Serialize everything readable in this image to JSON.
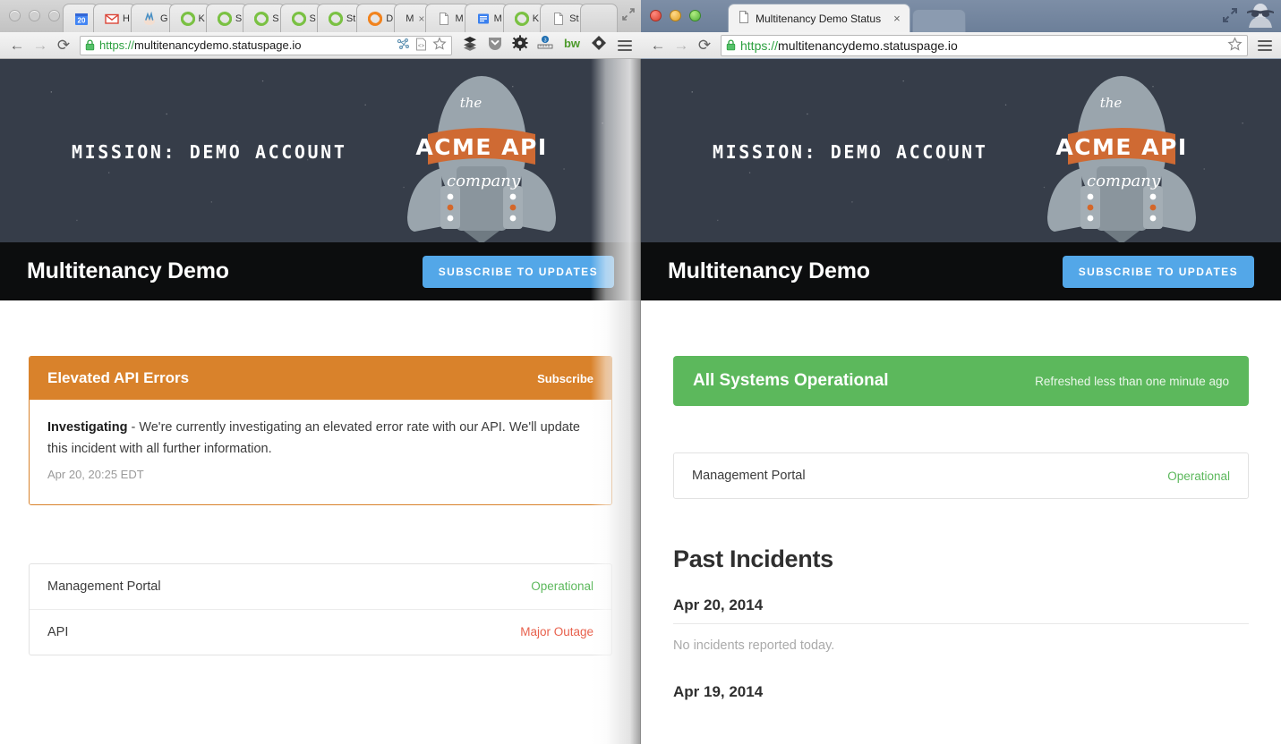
{
  "left_window": {
    "active": false,
    "traffic_lights": [
      "close",
      "minimize",
      "zoom"
    ],
    "tabs": [
      {
        "icon": "calendar-icon",
        "label": "20",
        "title": "20"
      },
      {
        "icon": "gmail-icon",
        "label": "H"
      },
      {
        "icon": "hand-icon",
        "label": "G"
      },
      {
        "icon": "statuspage-icon",
        "label": "K"
      },
      {
        "icon": "statuspage-icon",
        "label": "S"
      },
      {
        "icon": "statuspage-icon",
        "label": "S"
      },
      {
        "icon": "statuspage-icon",
        "label": "S"
      },
      {
        "icon": "statuspage-icon",
        "label": "St"
      },
      {
        "icon": "statuspage-orange-icon",
        "label": "D"
      },
      {
        "icon": "blank-icon",
        "label": "M",
        "closing": true
      },
      {
        "icon": "document-icon",
        "label": "M"
      },
      {
        "icon": "blue-doc-icon",
        "label": "M"
      },
      {
        "icon": "statuspage-icon",
        "label": "K"
      },
      {
        "icon": "document-icon",
        "label": "St"
      },
      {
        "icon": "empty-tab",
        "label": ""
      }
    ],
    "toolbar": {
      "back": "←",
      "forward": "→",
      "reload": "⟳",
      "url_scheme": "https://",
      "url_host": "multitenancydemo.statuspage.io",
      "omnibox_icons": [
        "mindmap-icon",
        "code-page-icon",
        "bookmark-star-icon"
      ],
      "extension_icons": [
        "buffer-icon",
        "pocket-icon",
        "gear-icon",
        "ruler-icon",
        "bitwarden-icon",
        "diamond-icon"
      ],
      "menu": "chrome-menu-icon"
    },
    "page": {
      "hero": {
        "mission_text": "MISSION: DEMO ACCOUNT",
        "logo": {
          "top": "the",
          "banner": "ACME API",
          "bottom": "company"
        }
      },
      "title": "Multitenancy Demo",
      "subscribe_button": "SUBSCRIBE TO UPDATES",
      "incident": {
        "title": "Elevated API Errors",
        "subscribe_link": "Subscribe",
        "status_word": "Investigating",
        "body": " - We're currently investigating an elevated error rate with our API. We'll update this incident with all further information.",
        "timestamp": "Apr 20, 20:25 EDT"
      },
      "components": [
        {
          "name": "Management Portal",
          "status": "Operational",
          "state": "operational"
        },
        {
          "name": "API",
          "status": "Major Outage",
          "state": "major"
        }
      ]
    }
  },
  "right_window": {
    "active": true,
    "traffic_lights": [
      "close",
      "minimize",
      "zoom"
    ],
    "tab": {
      "icon": "document-icon",
      "title": "Multitenancy Demo Status",
      "close": "×"
    },
    "window_controls": [
      "maximize-icon",
      "incognito-icon"
    ],
    "toolbar": {
      "back": "←",
      "forward": "→",
      "reload": "⟳",
      "url_scheme": "https://",
      "url_host": "multitenancydemo.statuspage.io",
      "omnibox_icons": [
        "bookmark-star-icon"
      ],
      "menu": "chrome-menu-icon"
    },
    "page": {
      "hero": {
        "mission_text": "MISSION: DEMO ACCOUNT",
        "logo": {
          "top": "the",
          "banner": "ACME API",
          "bottom": "company"
        }
      },
      "title": "Multitenancy Demo",
      "subscribe_button": "SUBSCRIBE TO UPDATES",
      "status_banner": {
        "title": "All Systems Operational",
        "refreshed": "Refreshed less than one minute ago"
      },
      "components": [
        {
          "name": "Management Portal",
          "status": "Operational",
          "state": "operational"
        }
      ],
      "past_incidents": {
        "heading": "Past Incidents",
        "entries": [
          {
            "date": "Apr 20, 2014",
            "note": "No incidents reported today."
          },
          {
            "date": "Apr 19, 2014",
            "note": ""
          }
        ]
      }
    }
  },
  "colors": {
    "accent_blue": "#53a7e8",
    "operational_green": "#5cb85c",
    "major_outage_red": "#e8604c",
    "incident_orange": "#d9822b",
    "hero_navy": "#363d49",
    "title_black": "#0c0d0e",
    "rocket_gray": "#9aa5ad"
  }
}
